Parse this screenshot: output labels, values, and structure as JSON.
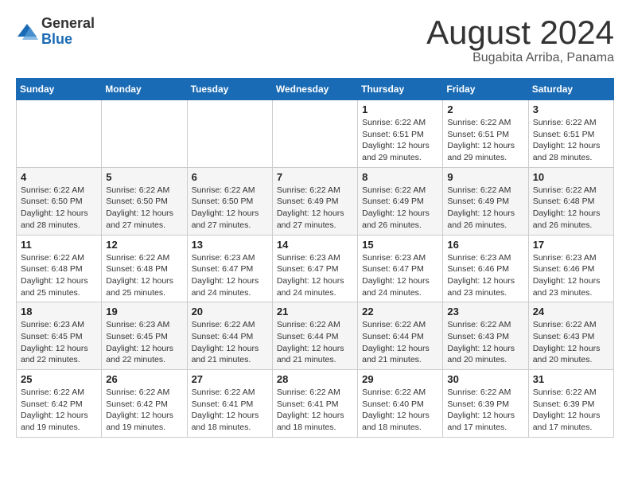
{
  "logo": {
    "general": "General",
    "blue": "Blue"
  },
  "title": {
    "month_year": "August 2024",
    "location": "Bugabita Arriba, Panama"
  },
  "weekdays": [
    "Sunday",
    "Monday",
    "Tuesday",
    "Wednesday",
    "Thursday",
    "Friday",
    "Saturday"
  ],
  "weeks": [
    [
      {
        "day": "",
        "info": ""
      },
      {
        "day": "",
        "info": ""
      },
      {
        "day": "",
        "info": ""
      },
      {
        "day": "",
        "info": ""
      },
      {
        "day": "1",
        "info": "Sunrise: 6:22 AM\nSunset: 6:51 PM\nDaylight: 12 hours and 29 minutes."
      },
      {
        "day": "2",
        "info": "Sunrise: 6:22 AM\nSunset: 6:51 PM\nDaylight: 12 hours and 29 minutes."
      },
      {
        "day": "3",
        "info": "Sunrise: 6:22 AM\nSunset: 6:51 PM\nDaylight: 12 hours and 28 minutes."
      }
    ],
    [
      {
        "day": "4",
        "info": "Sunrise: 6:22 AM\nSunset: 6:50 PM\nDaylight: 12 hours and 28 minutes."
      },
      {
        "day": "5",
        "info": "Sunrise: 6:22 AM\nSunset: 6:50 PM\nDaylight: 12 hours and 27 minutes."
      },
      {
        "day": "6",
        "info": "Sunrise: 6:22 AM\nSunset: 6:50 PM\nDaylight: 12 hours and 27 minutes."
      },
      {
        "day": "7",
        "info": "Sunrise: 6:22 AM\nSunset: 6:49 PM\nDaylight: 12 hours and 27 minutes."
      },
      {
        "day": "8",
        "info": "Sunrise: 6:22 AM\nSunset: 6:49 PM\nDaylight: 12 hours and 26 minutes."
      },
      {
        "day": "9",
        "info": "Sunrise: 6:22 AM\nSunset: 6:49 PM\nDaylight: 12 hours and 26 minutes."
      },
      {
        "day": "10",
        "info": "Sunrise: 6:22 AM\nSunset: 6:48 PM\nDaylight: 12 hours and 26 minutes."
      }
    ],
    [
      {
        "day": "11",
        "info": "Sunrise: 6:22 AM\nSunset: 6:48 PM\nDaylight: 12 hours and 25 minutes."
      },
      {
        "day": "12",
        "info": "Sunrise: 6:22 AM\nSunset: 6:48 PM\nDaylight: 12 hours and 25 minutes."
      },
      {
        "day": "13",
        "info": "Sunrise: 6:23 AM\nSunset: 6:47 PM\nDaylight: 12 hours and 24 minutes."
      },
      {
        "day": "14",
        "info": "Sunrise: 6:23 AM\nSunset: 6:47 PM\nDaylight: 12 hours and 24 minutes."
      },
      {
        "day": "15",
        "info": "Sunrise: 6:23 AM\nSunset: 6:47 PM\nDaylight: 12 hours and 24 minutes."
      },
      {
        "day": "16",
        "info": "Sunrise: 6:23 AM\nSunset: 6:46 PM\nDaylight: 12 hours and 23 minutes."
      },
      {
        "day": "17",
        "info": "Sunrise: 6:23 AM\nSunset: 6:46 PM\nDaylight: 12 hours and 23 minutes."
      }
    ],
    [
      {
        "day": "18",
        "info": "Sunrise: 6:23 AM\nSunset: 6:45 PM\nDaylight: 12 hours and 22 minutes."
      },
      {
        "day": "19",
        "info": "Sunrise: 6:23 AM\nSunset: 6:45 PM\nDaylight: 12 hours and 22 minutes."
      },
      {
        "day": "20",
        "info": "Sunrise: 6:22 AM\nSunset: 6:44 PM\nDaylight: 12 hours and 21 minutes."
      },
      {
        "day": "21",
        "info": "Sunrise: 6:22 AM\nSunset: 6:44 PM\nDaylight: 12 hours and 21 minutes."
      },
      {
        "day": "22",
        "info": "Sunrise: 6:22 AM\nSunset: 6:44 PM\nDaylight: 12 hours and 21 minutes."
      },
      {
        "day": "23",
        "info": "Sunrise: 6:22 AM\nSunset: 6:43 PM\nDaylight: 12 hours and 20 minutes."
      },
      {
        "day": "24",
        "info": "Sunrise: 6:22 AM\nSunset: 6:43 PM\nDaylight: 12 hours and 20 minutes."
      }
    ],
    [
      {
        "day": "25",
        "info": "Sunrise: 6:22 AM\nSunset: 6:42 PM\nDaylight: 12 hours and 19 minutes."
      },
      {
        "day": "26",
        "info": "Sunrise: 6:22 AM\nSunset: 6:42 PM\nDaylight: 12 hours and 19 minutes."
      },
      {
        "day": "27",
        "info": "Sunrise: 6:22 AM\nSunset: 6:41 PM\nDaylight: 12 hours and 18 minutes."
      },
      {
        "day": "28",
        "info": "Sunrise: 6:22 AM\nSunset: 6:41 PM\nDaylight: 12 hours and 18 minutes."
      },
      {
        "day": "29",
        "info": "Sunrise: 6:22 AM\nSunset: 6:40 PM\nDaylight: 12 hours and 18 minutes."
      },
      {
        "day": "30",
        "info": "Sunrise: 6:22 AM\nSunset: 6:39 PM\nDaylight: 12 hours and 17 minutes."
      },
      {
        "day": "31",
        "info": "Sunrise: 6:22 AM\nSunset: 6:39 PM\nDaylight: 12 hours and 17 minutes."
      }
    ]
  ]
}
